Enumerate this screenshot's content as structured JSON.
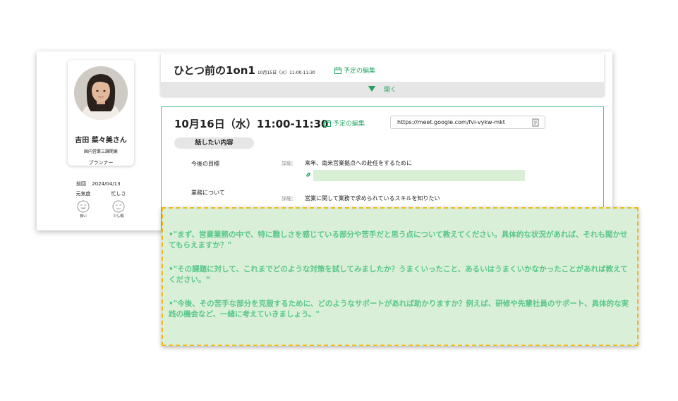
{
  "profile": {
    "name": "吉田 菜々美さん",
    "department": "国内営業三課関東",
    "role": "プランナー"
  },
  "previous": {
    "label": "前回",
    "date": "2024/04/13",
    "stats": [
      {
        "label": "元気度",
        "value": "良い"
      },
      {
        "label": "忙しさ",
        "value": "少し暇"
      }
    ]
  },
  "prev_meeting": {
    "title": "ひとつ前の1on1",
    "datetime": "10月15日（火）11:00-11:30",
    "edit_label": "予定の編集",
    "open_label": "開く"
  },
  "current_meeting": {
    "datetime": "10月16日（水）11:00-11:30",
    "edit_label": "予定の編集",
    "meet_url": "https://meet.google.com/fvi-vykw-mkt",
    "section_label": "話したい内容",
    "detail_label": "詳細：",
    "agenda": [
      {
        "label": "今後の目標",
        "detail": "来年、南米営業拠点への赴任をするために"
      },
      {
        "label": "業務について",
        "detail": "営業に関して業務で求められているスキルを知りたい"
      }
    ]
  },
  "suggestions": [
    "•\"まず、営業業務の中で、特に難しさを感じている部分や苦手だと思う点について教えてください。具体的な状況があれば、それも聞かせてもらえますか？\"",
    "•\"その課題に対して、これまでどのような対策を試してみましたか？うまくいったこと、あるいはうまくいかなかったことがあれば教えてください。“",
    "•\"今後、その苦手な部分を克服するために、どのようなサポートがあれば助かりますか？例えば、研修や先輩社員のサポート、具体的な実践の機会など、一緒に考えていきましょう。\""
  ],
  "colors": {
    "accent": "#27a868",
    "highlight_bg": "#d9efd7",
    "highlight_border": "#f0b81a",
    "suggestion_text": "#5ac78a"
  }
}
